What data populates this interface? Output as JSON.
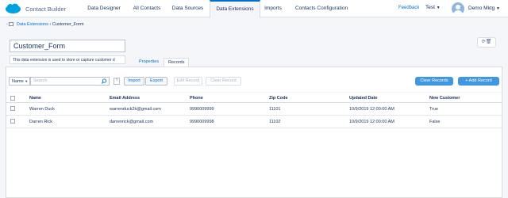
{
  "topnav": {
    "app_name": "Contact Builder",
    "tabs": [
      "Data Designer",
      "All Contacts",
      "Data Sources",
      "Data Extensions",
      "Imports",
      "Contacts Configuration"
    ],
    "feedback": "Feedback",
    "business_unit": "Test",
    "user": "Demo Mktg"
  },
  "breadcrumb": {
    "parent": "Data Extensions",
    "separator": "‹",
    "current": "Customer_Form"
  },
  "data_extension": {
    "name": "Customer_Form",
    "description": "This data extension is used to store or capture customer d"
  },
  "subtabs": [
    "Properties",
    "Records"
  ],
  "toolbar": {
    "field_select": "Name",
    "search_placeholder": "Search",
    "help": "?",
    "import": "Import",
    "export": "Export",
    "edit_record": "Edit Record",
    "clear_record": "Clear Record",
    "clear_records": "Clear Records",
    "add_record": "+ Add Record"
  },
  "table": {
    "columns": [
      "Name",
      "Email Address",
      "Phone",
      "Zip Code",
      "Updated Date",
      "New Customer"
    ],
    "rows": [
      [
        "Warren Duck",
        "warrenduck2k@gmail.com",
        "9990009999",
        "11101",
        "10/9/2019 12:00:00 AM",
        "True"
      ],
      [
        "Darren Rick",
        "darrenrick@gmail.com",
        "9990009998",
        "11102",
        "10/9/2019 12:00:00 AM",
        "False"
      ]
    ]
  },
  "colors": {
    "accent": "#0070d2",
    "primary_button": "#3f97e0",
    "brand": "#00a1e0"
  }
}
